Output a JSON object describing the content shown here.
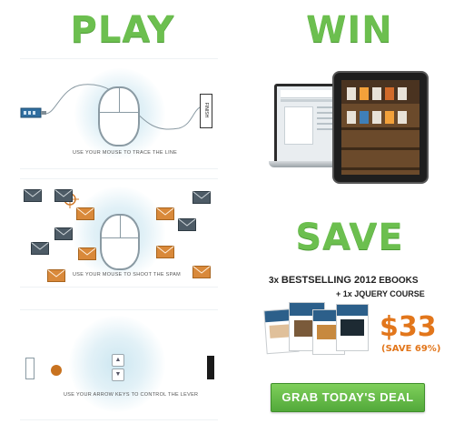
{
  "play": {
    "heading": "PLAY",
    "panels": [
      {
        "caption": "USE YOUR MOUSE TO TRACE THE LINE",
        "endpoint_label": "FINISH"
      },
      {
        "caption": "USE YOUR MOUSE TO SHOOT THE SPAM"
      },
      {
        "caption": "USE YOUR ARROW KEYS TO CONTROL THE LEVER",
        "keys": [
          "▲",
          "▼"
        ]
      }
    ]
  },
  "win": {
    "heading": "WIN",
    "device_icons": [
      "laptop-icon",
      "tablet-icon"
    ]
  },
  "save": {
    "heading": "SAVE",
    "offer_line1_prefix": "3x ",
    "offer_line1_bold": "BESTSELLING 2012",
    "offer_line1_suffix": " EBOOKS",
    "offer_line2": "+ 1x JQUERY COURSE",
    "price": "$33",
    "discount": "(SAVE 69%)",
    "button_label": "GRAB TODAY'S DEAL"
  },
  "colors": {
    "heading_green": "#6cbf4f",
    "price_orange": "#e2761b",
    "button_green": "#52a93a"
  }
}
